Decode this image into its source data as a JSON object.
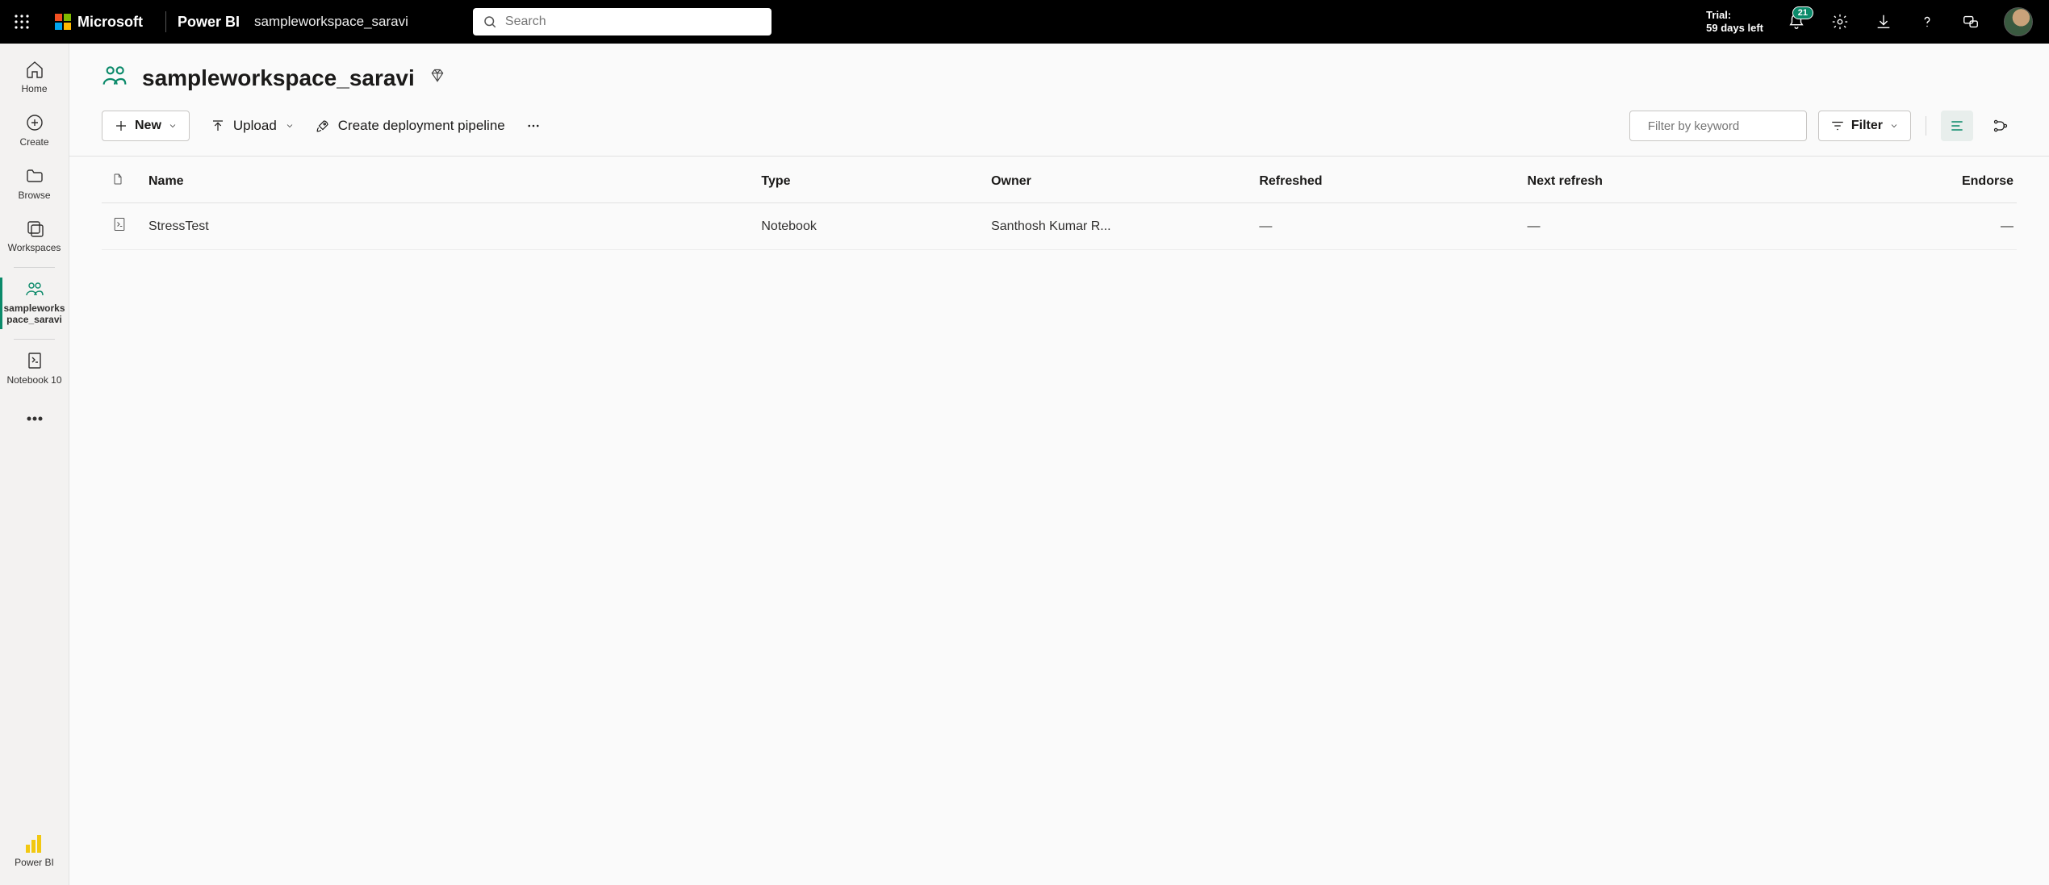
{
  "header": {
    "brand": "Microsoft",
    "app": "Power BI",
    "workspace_breadcrumb": "sampleworkspace_saravi",
    "search_placeholder": "Search",
    "trial_line1": "Trial:",
    "trial_line2": "59 days left",
    "notification_count": "21"
  },
  "rail": {
    "home": "Home",
    "create": "Create",
    "browse": "Browse",
    "workspaces": "Workspaces",
    "current_ws": "sampleworkspace_saravi",
    "notebook": "Notebook 10",
    "footer": "Power BI"
  },
  "page": {
    "title": "sampleworkspace_saravi"
  },
  "toolbar": {
    "new": "New",
    "upload": "Upload",
    "deploy": "Create deployment pipeline",
    "filter_placeholder": "Filter by keyword",
    "filter": "Filter"
  },
  "columns": {
    "name": "Name",
    "type": "Type",
    "owner": "Owner",
    "refreshed": "Refreshed",
    "next_refresh": "Next refresh",
    "endorse": "Endorse"
  },
  "rows": [
    {
      "name": "StressTest",
      "type": "Notebook",
      "owner": "Santhosh Kumar R...",
      "refreshed": "—",
      "next_refresh": "—",
      "endorse": "—"
    }
  ]
}
